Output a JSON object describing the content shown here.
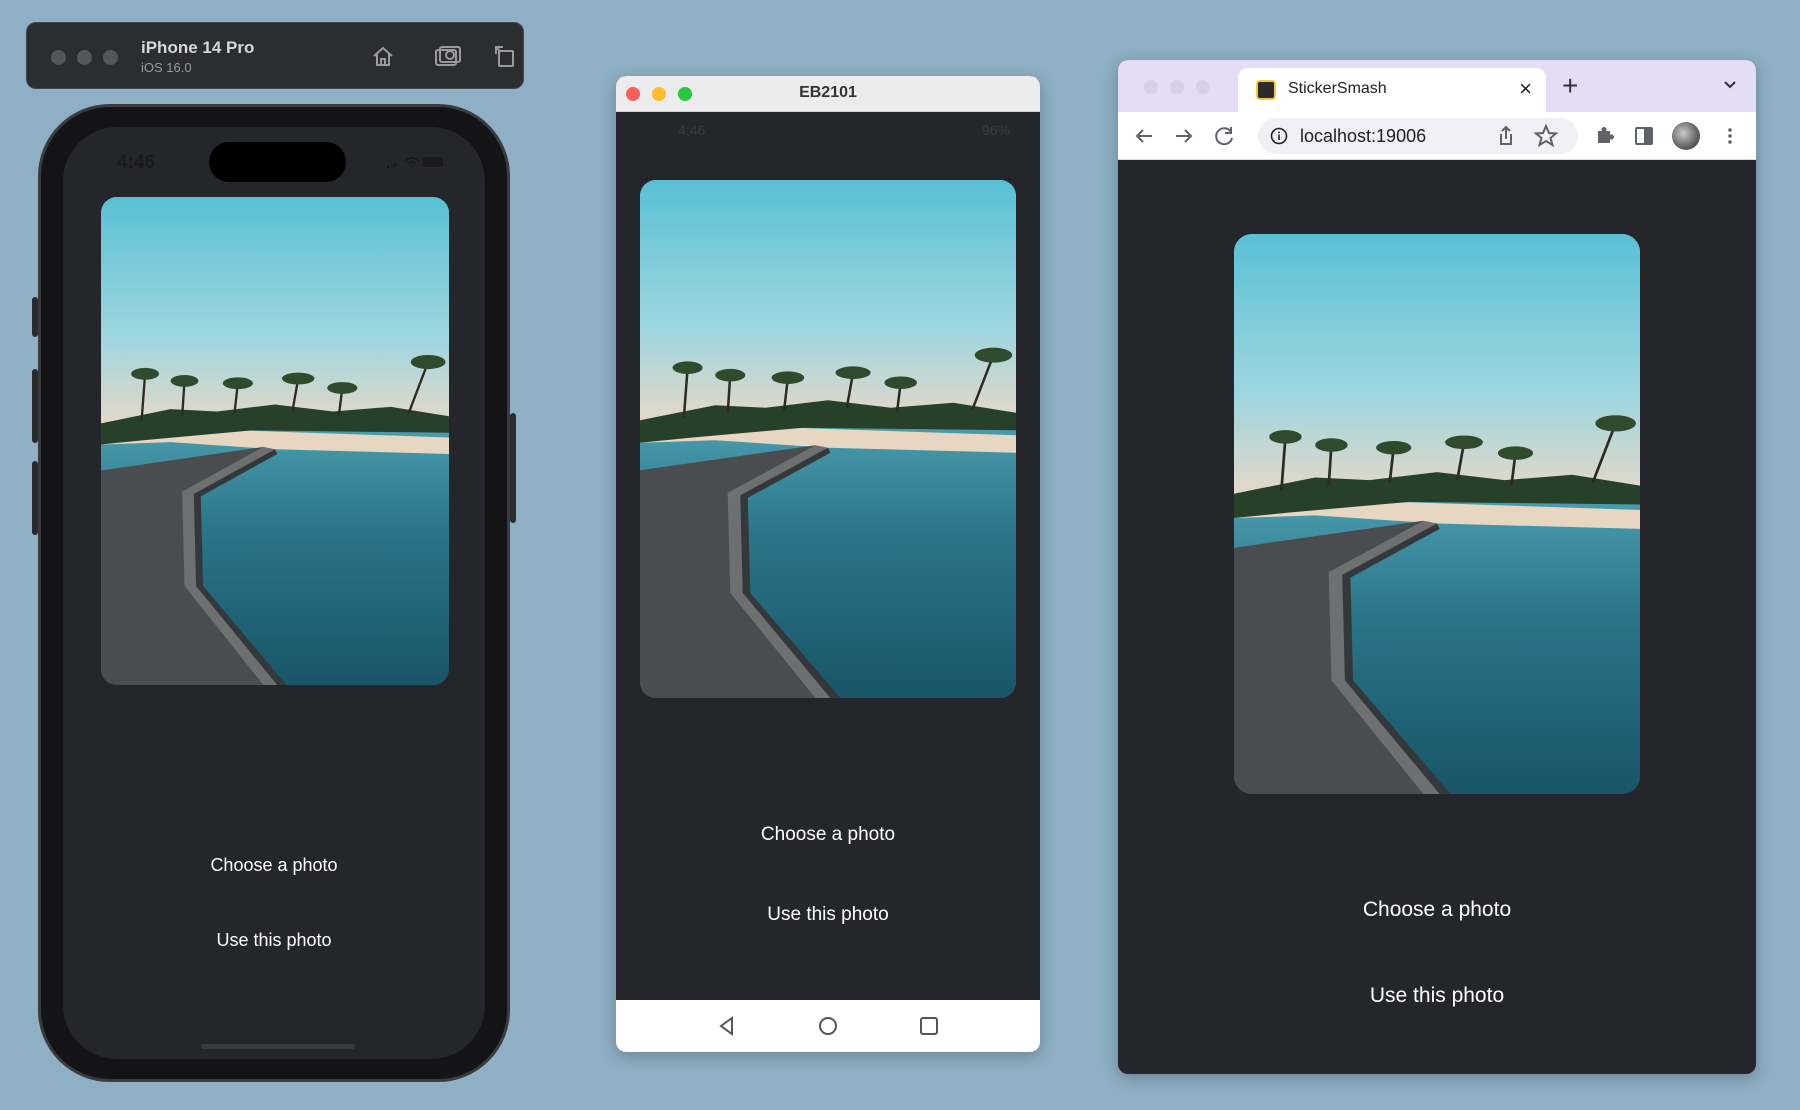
{
  "ios": {
    "device_name": "iPhone 14 Pro",
    "os_version": "iOS 16.0",
    "status_time": "4:46",
    "toolbar_icons": [
      "home-icon",
      "screenshot-icon",
      "rotate-icon"
    ]
  },
  "android": {
    "window_title": "EB2101",
    "status_time": "4:46",
    "battery": "96%",
    "nav_icons": [
      "back-icon",
      "home-icon",
      "recents-icon"
    ]
  },
  "browser": {
    "tab_title": "StickerSmash",
    "url": "localhost:19006"
  },
  "app": {
    "choose_label": "Choose a photo",
    "use_label": "Use this photo",
    "background": "#25262c"
  },
  "colors": {
    "desktop": "#8eafc4",
    "mac_close": "#fe5f57",
    "mac_min": "#febc2e",
    "mac_max": "#28c840",
    "chrome_tabstrip": "#e5dcf5"
  }
}
